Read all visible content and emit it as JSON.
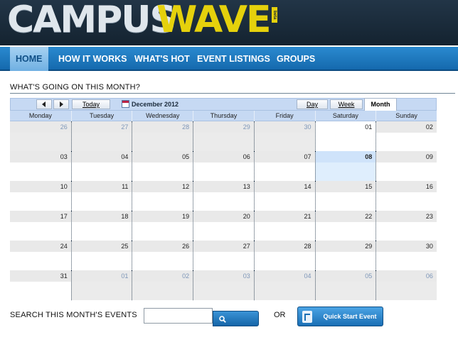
{
  "brand": {
    "part1": "CAMPUS",
    "part2": "WAVE",
    "badge": "beta"
  },
  "nav": {
    "items": [
      {
        "label": "HOME",
        "active": true
      },
      {
        "label": "HOW IT WORKS"
      },
      {
        "label": "WHAT'S HOT"
      },
      {
        "label": "EVENT LISTINGS"
      },
      {
        "label": "GROUPS"
      }
    ]
  },
  "section": {
    "title": "WHAT'S GOING ON THIS MONTH?"
  },
  "toolbar": {
    "today": "Today",
    "current_month": "December 2012",
    "views": {
      "day": "Day",
      "week": "Week",
      "month": "Month"
    },
    "active_view": "Month"
  },
  "calendar": {
    "weekdays": [
      "Monday",
      "Tuesday",
      "Wednesday",
      "Thursday",
      "Friday",
      "Saturday",
      "Sunday"
    ],
    "today": "08",
    "weeks": [
      [
        {
          "d": "26",
          "other": true
        },
        {
          "d": "27",
          "other": true
        },
        {
          "d": "28",
          "other": true
        },
        {
          "d": "29",
          "other": true
        },
        {
          "d": "30",
          "other": true
        },
        {
          "d": "01"
        },
        {
          "d": "02"
        }
      ],
      [
        {
          "d": "03"
        },
        {
          "d": "04"
        },
        {
          "d": "05"
        },
        {
          "d": "06"
        },
        {
          "d": "07"
        },
        {
          "d": "08",
          "today": true
        },
        {
          "d": "09"
        }
      ],
      [
        {
          "d": "10"
        },
        {
          "d": "11"
        },
        {
          "d": "12"
        },
        {
          "d": "13"
        },
        {
          "d": "14"
        },
        {
          "d": "15"
        },
        {
          "d": "16"
        }
      ],
      [
        {
          "d": "17"
        },
        {
          "d": "18"
        },
        {
          "d": "19"
        },
        {
          "d": "20"
        },
        {
          "d": "21"
        },
        {
          "d": "22"
        },
        {
          "d": "23"
        }
      ],
      [
        {
          "d": "24"
        },
        {
          "d": "25"
        },
        {
          "d": "26"
        },
        {
          "d": "27"
        },
        {
          "d": "28"
        },
        {
          "d": "29"
        },
        {
          "d": "30"
        }
      ],
      [
        {
          "d": "31"
        },
        {
          "d": "01",
          "other": true
        },
        {
          "d": "02",
          "other": true
        },
        {
          "d": "03",
          "other": true
        },
        {
          "d": "04",
          "other": true
        },
        {
          "d": "05",
          "other": true
        },
        {
          "d": "06",
          "other": true
        }
      ]
    ]
  },
  "search": {
    "label": "SEARCH THIS MONTH'S EVENTS",
    "placeholder": "",
    "value": "",
    "button_icon": "search-icon",
    "or_label": "OR"
  },
  "quick_start": {
    "label": "Quick Start Event",
    "icon": "event-icon"
  },
  "colors": {
    "nav": "#1a74b9",
    "accent": "#e5d10c",
    "header": "#1a2b3a"
  }
}
